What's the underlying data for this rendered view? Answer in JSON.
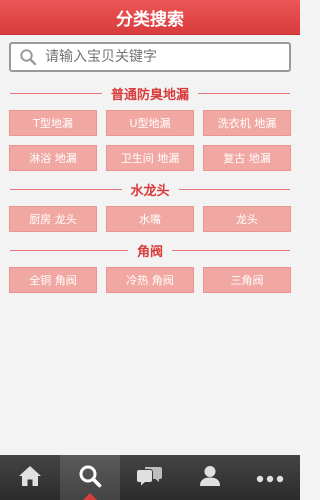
{
  "header": {
    "title": "分类搜索"
  },
  "search": {
    "placeholder": "请输入宝贝关键字"
  },
  "sections": [
    {
      "title": "普通防臭地漏",
      "items": [
        "T型地漏",
        "U型地漏",
        "洗衣机 地漏",
        "淋浴 地漏",
        "卫生间 地漏",
        "复古 地漏"
      ]
    },
    {
      "title": "水龙头",
      "items": [
        "厨房 龙头",
        "水嘴",
        "龙头"
      ]
    },
    {
      "title": "角阀",
      "items": [
        "全铜 角阀",
        "冷热 角阀",
        "三角阀"
      ]
    }
  ],
  "nav": {
    "items": [
      {
        "icon": "home-icon"
      },
      {
        "icon": "search-icon",
        "active": true
      },
      {
        "icon": "chat-icon"
      },
      {
        "icon": "user-icon"
      },
      {
        "icon": "more-icon"
      }
    ],
    "accent": "#d93c3c"
  }
}
